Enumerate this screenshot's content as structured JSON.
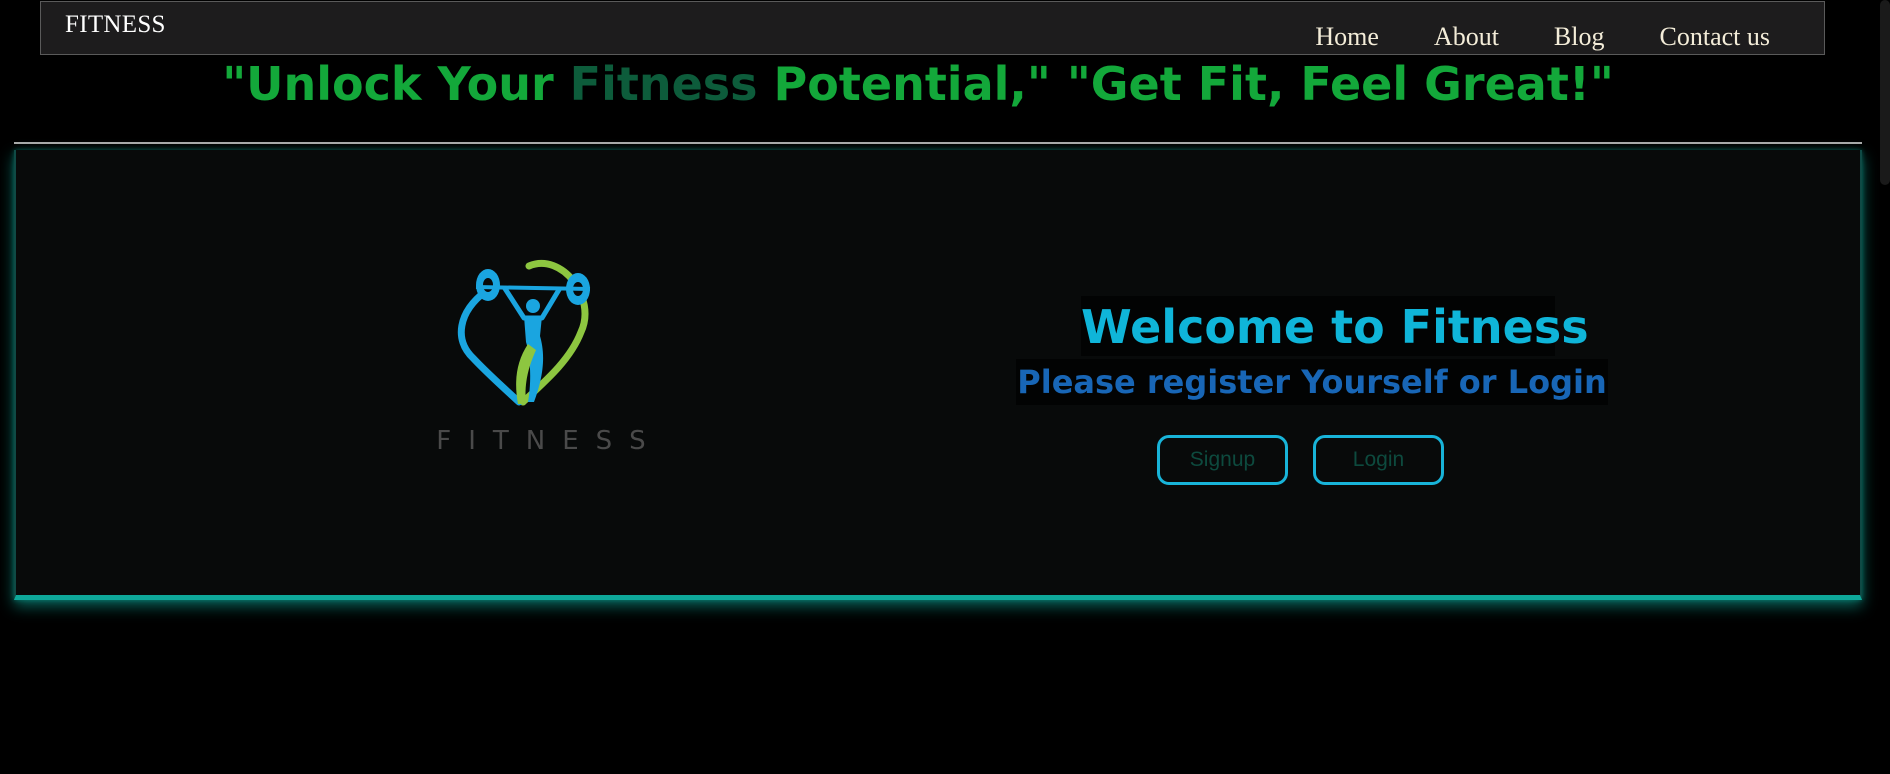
{
  "navbar": {
    "brand": "FITNESS",
    "links": [
      {
        "label": "Home"
      },
      {
        "label": "About"
      },
      {
        "label": "Blog"
      },
      {
        "label": "Contact us"
      }
    ]
  },
  "slogan": {
    "part1": "\"Unlock Your ",
    "accent": "Fitness",
    "part2": " Potential,\" \"Get Fit, Feel Great!\""
  },
  "hero": {
    "logo": {
      "icon": "weightlifter-logo-icon",
      "text": "FITNESS",
      "colors": {
        "blue": "#1aa5e0",
        "green": "#8dc640"
      }
    },
    "welcome_title": "Welcome to Fitness",
    "subtitle": "Please register Yourself or Login",
    "buttons": {
      "signup": "Signup",
      "login": "Login"
    }
  },
  "colors": {
    "background": "#000000",
    "navbar": "#1d1c1d",
    "slogan_green": "#13a83a",
    "slogan_accent": "#0d5c3b",
    "welcome_cyan": "#0fb5d9",
    "subtitle_blue": "#1866b6",
    "button_border": "#18b4d9",
    "hero_glow": "#0ea89a"
  }
}
